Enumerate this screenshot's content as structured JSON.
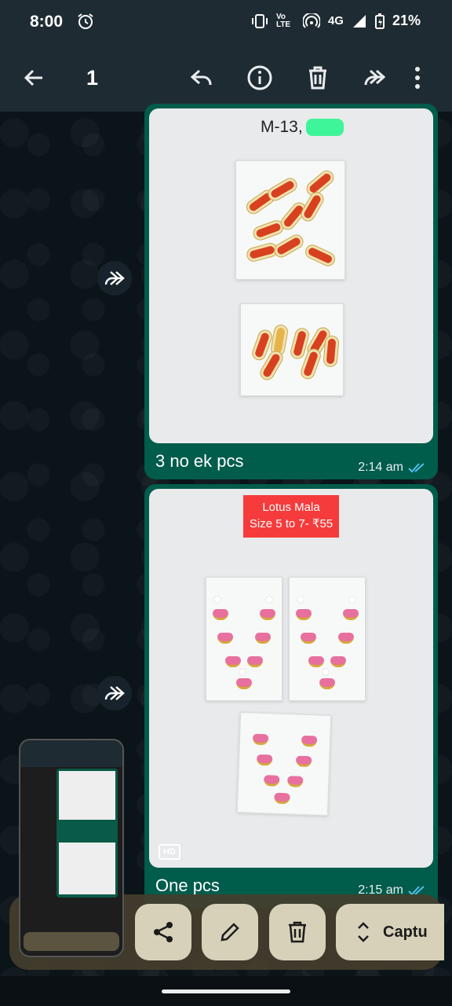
{
  "status_bar": {
    "time": "8:00",
    "network": "4G",
    "battery": "21%",
    "volte": "Vo LTE"
  },
  "toolbar": {
    "selected_count": "1"
  },
  "messages": [
    {
      "label_text": "M-13,",
      "caption": "3 no ek pcs",
      "time": "2:14 am"
    },
    {
      "tag_line1": "Lotus Mala",
      "tag_line2": "Size 5 to 7- ₹55",
      "hd": "HD",
      "caption": "One pcs",
      "time": "2:15 am"
    }
  ],
  "screenshot_actions": {
    "capture_label": "Captu"
  },
  "colors": {
    "bubble": "#005c4b",
    "toolbar": "#1f2b33",
    "tick": "#53bdeb"
  }
}
